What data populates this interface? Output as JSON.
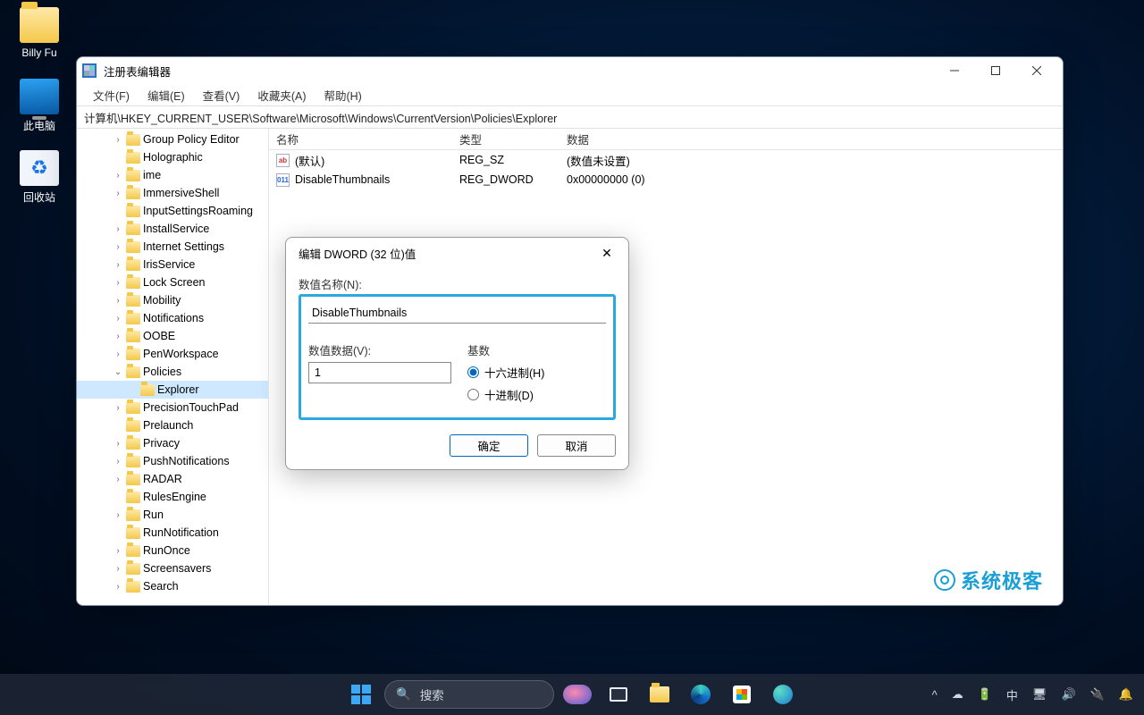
{
  "desktop": {
    "icons": [
      {
        "label": "Billy Fu",
        "kind": "folder"
      },
      {
        "label": "此电脑",
        "kind": "pc"
      },
      {
        "label": "回收站",
        "kind": "recycle"
      }
    ]
  },
  "regedit": {
    "title": "注册表编辑器",
    "menu": [
      "文件(F)",
      "编辑(E)",
      "查看(V)",
      "收藏夹(A)",
      "帮助(H)"
    ],
    "address": "计算机\\HKEY_CURRENT_USER\\Software\\Microsoft\\Windows\\CurrentVersion\\Policies\\Explorer",
    "columns": {
      "name": "名称",
      "type": "类型",
      "data": "数据"
    },
    "tree": [
      {
        "label": "Group Policy Editor",
        "indent": 2,
        "exp": ">"
      },
      {
        "label": "Holographic",
        "indent": 2,
        "exp": ""
      },
      {
        "label": "ime",
        "indent": 2,
        "exp": ">"
      },
      {
        "label": "ImmersiveShell",
        "indent": 2,
        "exp": ">"
      },
      {
        "label": "InputSettingsRoaming",
        "indent": 2,
        "exp": ""
      },
      {
        "label": "InstallService",
        "indent": 2,
        "exp": ">"
      },
      {
        "label": "Internet Settings",
        "indent": 2,
        "exp": ">"
      },
      {
        "label": "IrisService",
        "indent": 2,
        "exp": ">"
      },
      {
        "label": "Lock Screen",
        "indent": 2,
        "exp": ">"
      },
      {
        "label": "Mobility",
        "indent": 2,
        "exp": ">"
      },
      {
        "label": "Notifications",
        "indent": 2,
        "exp": ">"
      },
      {
        "label": "OOBE",
        "indent": 2,
        "exp": ">"
      },
      {
        "label": "PenWorkspace",
        "indent": 2,
        "exp": ">"
      },
      {
        "label": "Policies",
        "indent": 2,
        "exp": "v"
      },
      {
        "label": "Explorer",
        "indent": 3,
        "exp": "",
        "selected": true
      },
      {
        "label": "PrecisionTouchPad",
        "indent": 2,
        "exp": ">"
      },
      {
        "label": "Prelaunch",
        "indent": 2,
        "exp": ""
      },
      {
        "label": "Privacy",
        "indent": 2,
        "exp": ">"
      },
      {
        "label": "PushNotifications",
        "indent": 2,
        "exp": ">"
      },
      {
        "label": "RADAR",
        "indent": 2,
        "exp": ">"
      },
      {
        "label": "RulesEngine",
        "indent": 2,
        "exp": ""
      },
      {
        "label": "Run",
        "indent": 2,
        "exp": ">"
      },
      {
        "label": "RunNotification",
        "indent": 2,
        "exp": ""
      },
      {
        "label": "RunOnce",
        "indent": 2,
        "exp": ">"
      },
      {
        "label": "Screensavers",
        "indent": 2,
        "exp": ">"
      },
      {
        "label": "Search",
        "indent": 2,
        "exp": ">"
      }
    ],
    "values": [
      {
        "name": "(默认)",
        "type": "REG_SZ",
        "data": "(数值未设置)",
        "icon": "ab"
      },
      {
        "name": "DisableThumbnails",
        "type": "REG_DWORD",
        "data": "0x00000000 (0)",
        "icon": "dw"
      }
    ],
    "watermark": "系统极客"
  },
  "dialog": {
    "title": "编辑 DWORD (32 位)值",
    "name_label": "数值名称(N):",
    "name_value": "DisableThumbnails",
    "data_label": "数值数据(V):",
    "data_value": "1",
    "base_label": "基数",
    "radio_hex": "十六进制(H)",
    "radio_dec": "十进制(D)",
    "ok": "确定",
    "cancel": "取消"
  },
  "taskbar": {
    "search_placeholder": "搜索",
    "tray": {
      "ime": "中",
      "up": "^"
    }
  }
}
